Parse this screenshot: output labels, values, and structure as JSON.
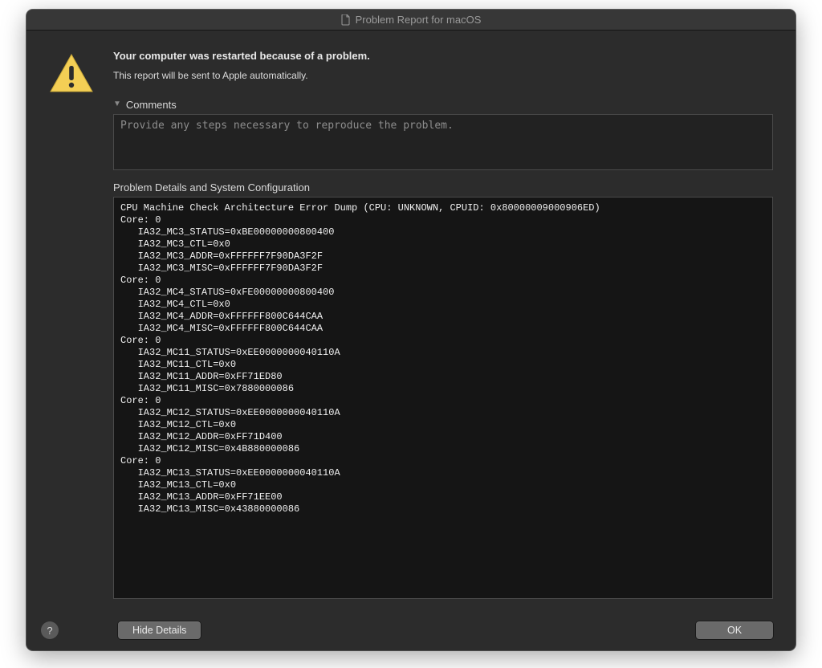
{
  "window": {
    "title": "Problem Report for macOS"
  },
  "header": {
    "title": "Your computer was restarted because of a problem.",
    "subtitle": "This report will be sent to Apple automatically."
  },
  "comments": {
    "label": "Comments",
    "placeholder": "Provide any steps necessary to reproduce the problem.",
    "value": ""
  },
  "details": {
    "label": "Problem Details and System Configuration",
    "text": "CPU Machine Check Architecture Error Dump (CPU: UNKNOWN, CPUID: 0x80000009000906ED)\nCore: 0\n   IA32_MC3_STATUS=0xBE00000000800400\n   IA32_MC3_CTL=0x0\n   IA32_MC3_ADDR=0xFFFFFF7F90DA3F2F\n   IA32_MC3_MISC=0xFFFFFF7F90DA3F2F\nCore: 0\n   IA32_MC4_STATUS=0xFE00000000800400\n   IA32_MC4_CTL=0x0\n   IA32_MC4_ADDR=0xFFFFFF800C644CAA\n   IA32_MC4_MISC=0xFFFFFF800C644CAA\nCore: 0\n   IA32_MC11_STATUS=0xEE0000000040110A\n   IA32_MC11_CTL=0x0\n   IA32_MC11_ADDR=0xFF71ED80\n   IA32_MC11_MISC=0x7880000086\nCore: 0\n   IA32_MC12_STATUS=0xEE0000000040110A\n   IA32_MC12_CTL=0x0\n   IA32_MC12_ADDR=0xFF71D400\n   IA32_MC12_MISC=0x4B880000086\nCore: 0\n   IA32_MC13_STATUS=0xEE0000000040110A\n   IA32_MC13_CTL=0x0\n   IA32_MC13_ADDR=0xFF71EE00\n   IA32_MC13_MISC=0x43880000086"
  },
  "footer": {
    "help": "?",
    "hide_details": "Hide Details",
    "ok": "OK"
  }
}
